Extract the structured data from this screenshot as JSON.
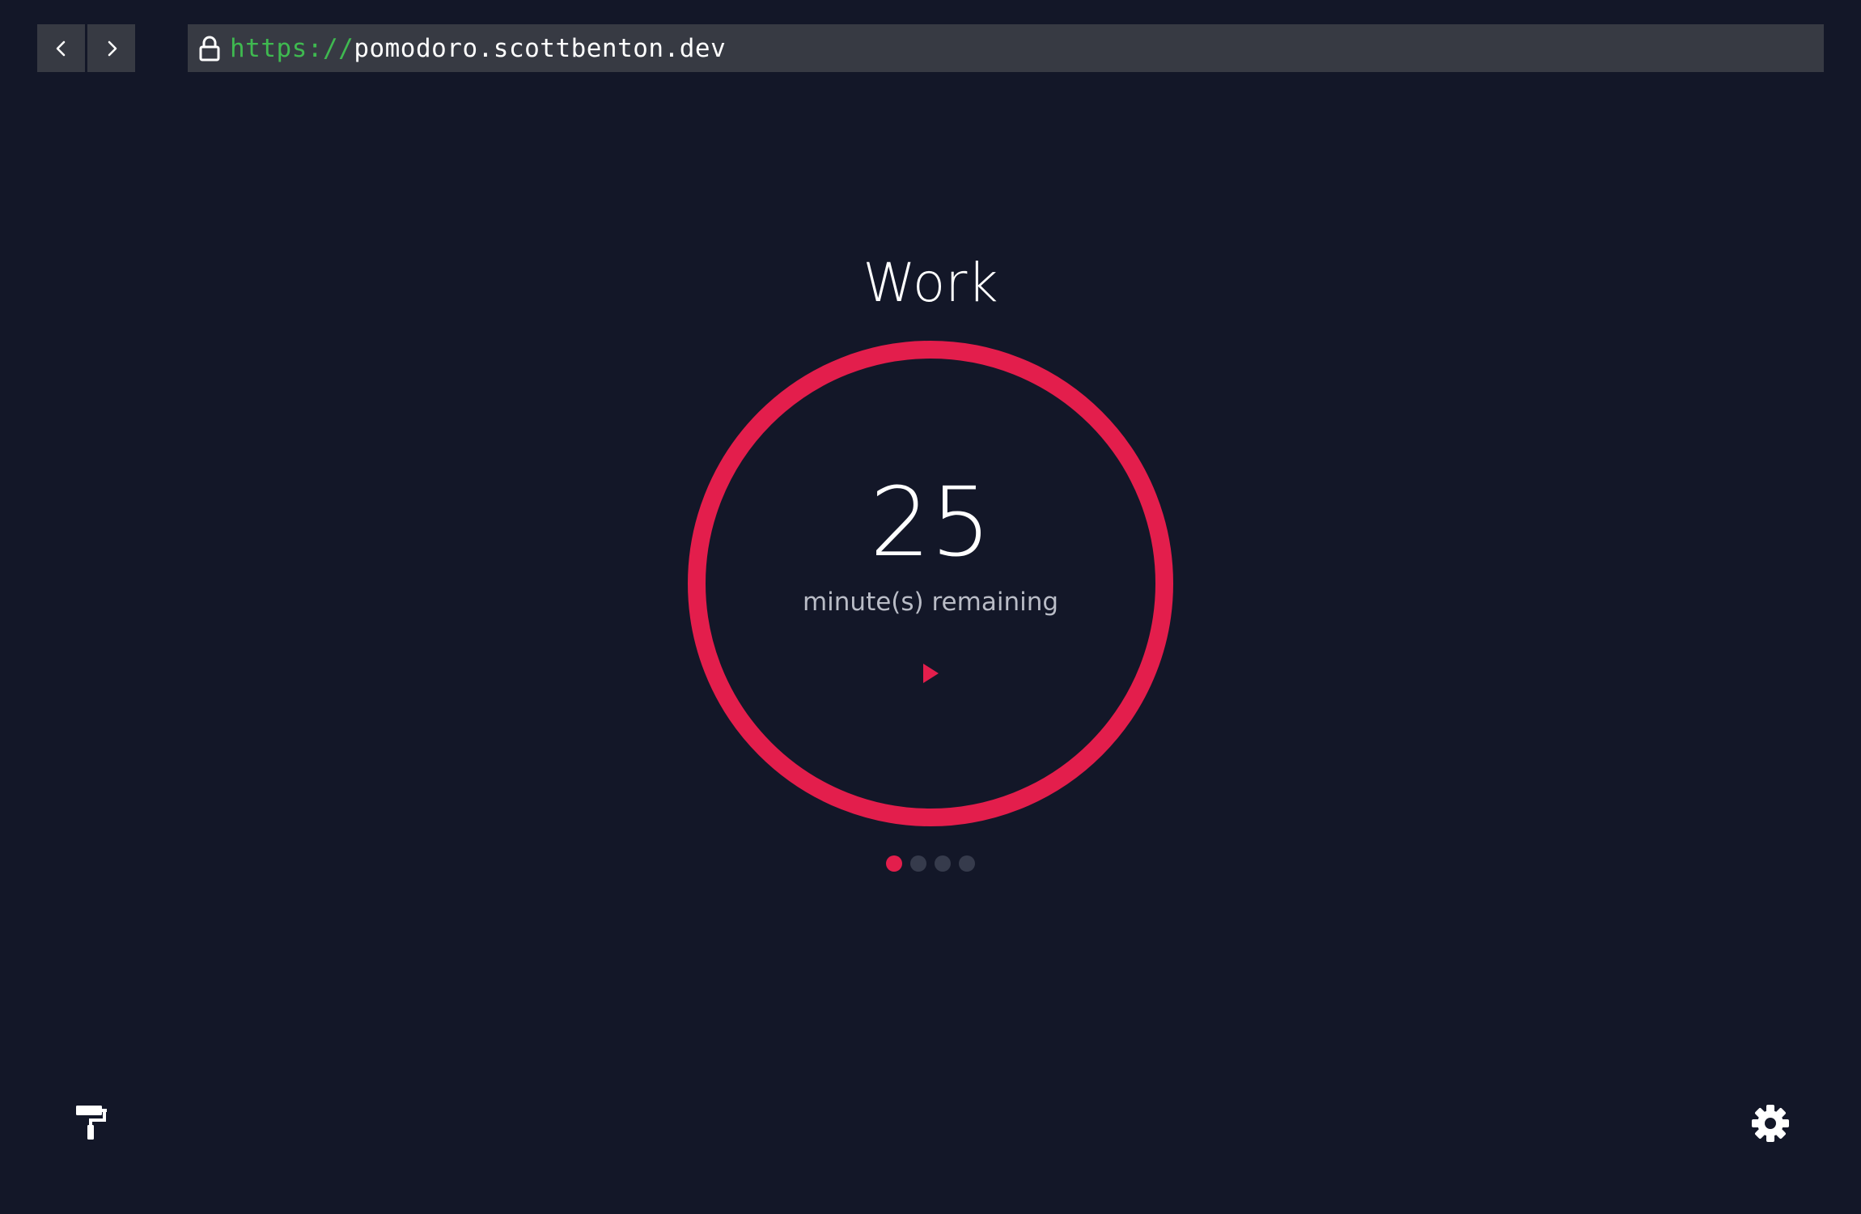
{
  "browser": {
    "url_scheme": "https://",
    "url_host": "pomodoro.scottbenton.dev",
    "icons": {
      "back": "chevron-left-icon",
      "forward": "chevron-right-icon",
      "lock": "lock-icon"
    }
  },
  "timer": {
    "mode": "Work",
    "minutes": "25",
    "label": "minute(s) remaining",
    "progress": 1.0,
    "sessions_total": 4,
    "sessions_current": 1,
    "play_icon": "play-icon"
  },
  "footer": {
    "theme_icon": "paint-roller-icon",
    "settings_icon": "gear-icon"
  },
  "colors": {
    "background": "#131728",
    "accent": "#e31e4c",
    "chrome": "#373a43",
    "scheme_green": "#3fb950",
    "dot_inactive": "#363b4c"
  }
}
